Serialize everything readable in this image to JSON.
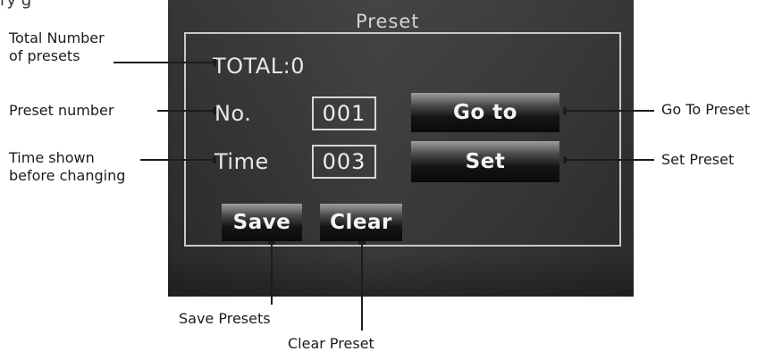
{
  "page": {
    "top_fragment": "ry    g"
  },
  "panel": {
    "title": "Preset",
    "total_label": "TOTAL:0",
    "number_label": "No.",
    "number_value": "001",
    "time_label": "Time",
    "time_value": "003",
    "goto_label": "Go to",
    "set_label": "Set",
    "save_label": "Save",
    "clear_label": "Clear"
  },
  "callouts": {
    "total_presets": "Total Number\nof presets",
    "preset_number": "Preset number",
    "time_shown": "Time shown\nbefore changing",
    "go_to_preset": "Go To Preset",
    "set_preset": "Set Preset",
    "save_presets": "Save Presets",
    "clear_preset": "Clear Preset"
  },
  "colors": {
    "leader_line": "#1c1c1c"
  }
}
